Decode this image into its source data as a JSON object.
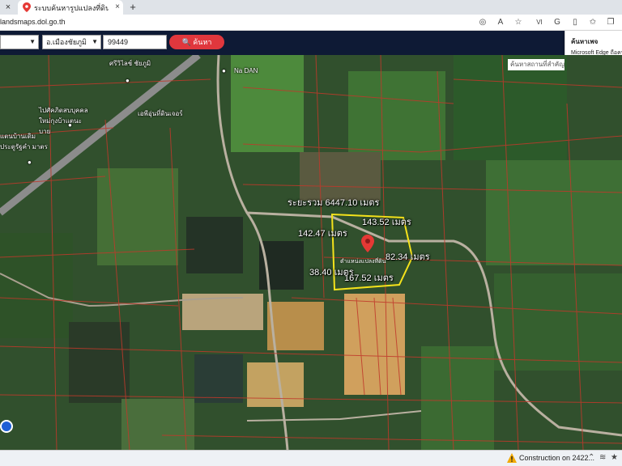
{
  "browser": {
    "tab_title": "ระบบค้นหารูปแปลงที่ดิน (LandsMaps)",
    "url": "landsmaps.dol.go.th",
    "tab_close": "×",
    "new_tab": "+",
    "toolbar_icons": [
      "info-icon",
      "read-aloud-icon",
      "favorites-icon",
      "count-badge",
      "edge-copilot-icon",
      "split-screen-icon",
      "add-favorite-icon",
      "collections-icon"
    ],
    "badge_text": "VI"
  },
  "navbar": {
    "province_value": "",
    "district_value": "อ.เมืองชัยภูมิ",
    "parcel_number": "99449",
    "search_label": "ค้นหา"
  },
  "side_panel": {
    "title": "ค้นหาเพจ",
    "item": "Microsoft Edge ถือคน"
  },
  "map": {
    "place_search_placeholder": "ค้นหาสถานที่สำคัญ",
    "pois": [
      {
        "name": "Na DAN"
      },
      {
        "name": "ศรีวิไลช์ ชัยภูมิ"
      },
      {
        "name": "ไปศัคภิตสบบุคคล ใหม่กุงบ้าแตนะบาย"
      },
      {
        "name": "เอพีอุ่นที่ดินเจอร์"
      },
      {
        "name": "แตนบ้านเดิม ประตูรัฐคำ มาตร"
      }
    ],
    "measurements": {
      "total": "ระยะรวม 6447.10 เมตร",
      "total_overlap": "664",
      "top": "143.52 เมตร",
      "left": "142.47 เมตร",
      "right": "82.34 เมตร",
      "bottom_left": "38.40 เมตร",
      "bottom": "167.52 เมตร"
    },
    "parcel_label": "ตำแหน่งแปลงที่ดิน",
    "parcel_color": "#f4e21b",
    "pin_color": "#e53935",
    "boundary_color": "#c0392b"
  },
  "taskbar": {
    "notification": "Construction on 2422...",
    "icons": [
      "up-arrow-icon",
      "wifi-icon",
      "volume-icon",
      "star-icon"
    ]
  }
}
